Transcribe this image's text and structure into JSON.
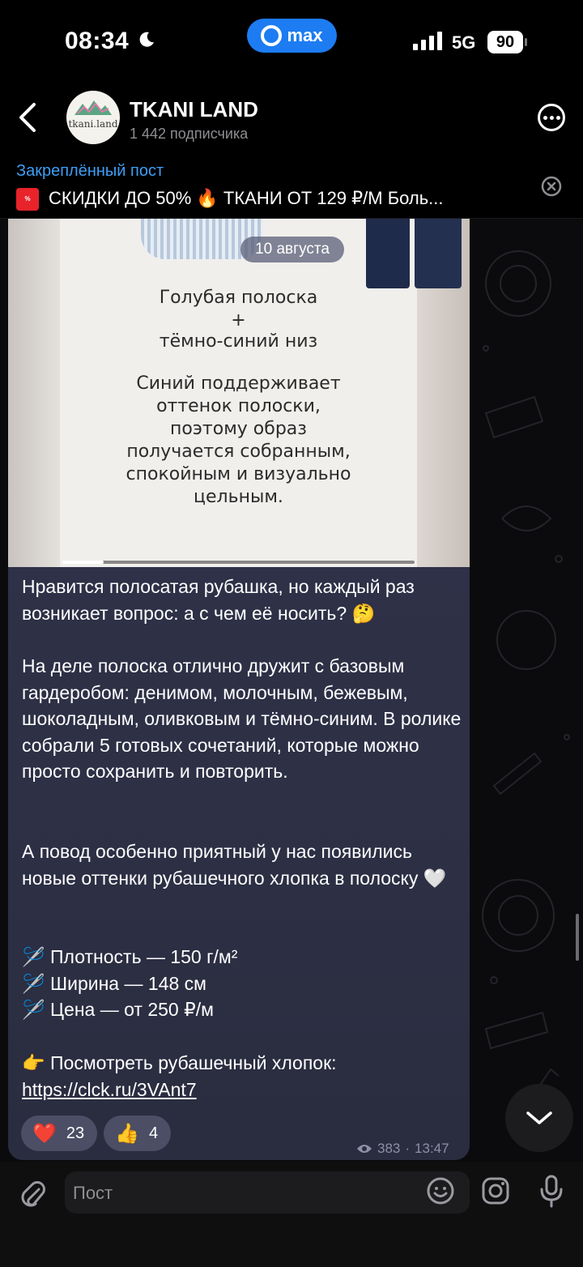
{
  "status_bar": {
    "time": "08:34",
    "app_pill": "max",
    "network": "5G",
    "battery": "90"
  },
  "header": {
    "channel_name": "TKANI LAND",
    "subscribers": "1 442 подписчика",
    "avatar_text": "tkani.land"
  },
  "pinned": {
    "title": "Закреплённый пост",
    "text": "СКИДКИ ДО 50% 🔥 ТКАНИ ОТ 129 ₽/М Боль..."
  },
  "video": {
    "date": "10 августа",
    "lines": [
      "Голубая полоска",
      "+",
      "тёмно-синий низ",
      "Синий поддерживает",
      "оттенок полоски,",
      "поэтому образ",
      "получается собранным,",
      "спокойным и визуально",
      "цельным."
    ],
    "progress": 0.12
  },
  "message": {
    "p1": "Нравится полосатая рубашка, но каждый раз возникает вопрос: а с чем её носить? 🤔",
    "p2": "На деле полоска отлично дружит с базовым гардеробом: денимом, молочным, бежевым, шоколадным, оливковым и тёмно-синим. В ролике собрали 5 готовых сочетаний, которые можно просто сохранить и повторить.",
    "p3": "А повод особенно приятный у нас появились новые оттенки рубашечного хлопка в полоску 🤍",
    "spec1": "🪡 Плотность — 150 г/м²",
    "spec2": "🪡 Ширина — 148 см",
    "spec3": "🪡 Цена — от 250 ₽/м",
    "cta": "👉 Посмотреть рубашечный хлопок: ",
    "link": "https://clck.ru/3VAnt7",
    "views": "383",
    "time": "13:47"
  },
  "reactions": [
    {
      "emoji": "❤️",
      "count": "23"
    },
    {
      "emoji": "👍",
      "count": "4"
    }
  ],
  "input": {
    "placeholder": "Пост"
  }
}
